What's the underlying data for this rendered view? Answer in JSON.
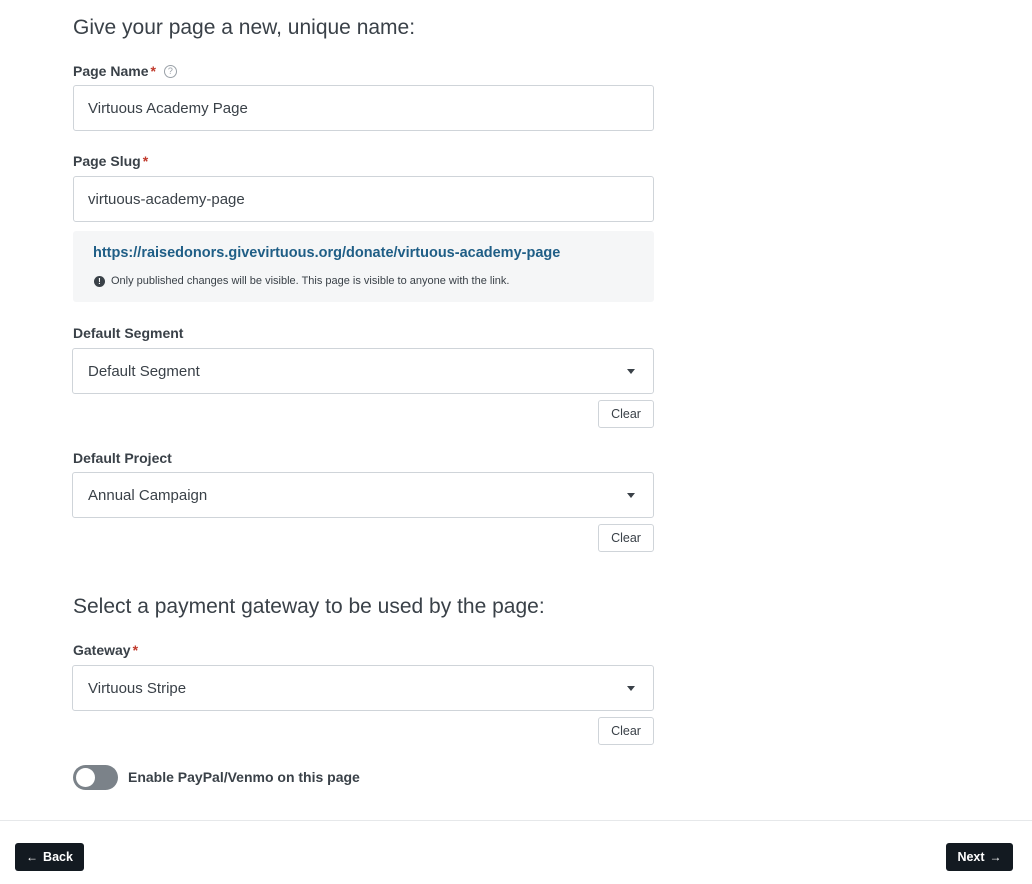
{
  "page_section": {
    "title": "Give your page a new, unique name:"
  },
  "page_name": {
    "label": "Page Name",
    "required_mark": "*",
    "help_icon": "?",
    "value": "Virtuous Academy Page"
  },
  "page_slug": {
    "label": "Page Slug",
    "required_mark": "*",
    "value": "virtuous-academy-page"
  },
  "url_preview": {
    "link": "https://raisedonors.givevirtuous.org/donate/virtuous-academy-page",
    "info_icon": "!",
    "note": "Only published changes will be visible. This page is visible to anyone with the link."
  },
  "default_segment": {
    "label": "Default Segment",
    "value": "Default Segment",
    "clear_label": "Clear"
  },
  "default_project": {
    "label": "Default Project",
    "value": "Annual Campaign",
    "clear_label": "Clear"
  },
  "gateway_section": {
    "title": "Select a payment gateway to be used by the page:"
  },
  "gateway": {
    "label": "Gateway",
    "required_mark": "*",
    "value": "Virtuous Stripe",
    "clear_label": "Clear"
  },
  "paypal_toggle": {
    "label": "Enable PayPal/Venmo on this page",
    "enabled": false
  },
  "footer": {
    "back_label": "Back",
    "back_icon": "arrow-left-icon",
    "next_label": "Next",
    "next_icon": "arrow-right-icon"
  },
  "colors": {
    "link": "#1f5e86",
    "required": "#c0392b",
    "button_dark": "#131a21",
    "toggle_off": "#7b8289"
  }
}
